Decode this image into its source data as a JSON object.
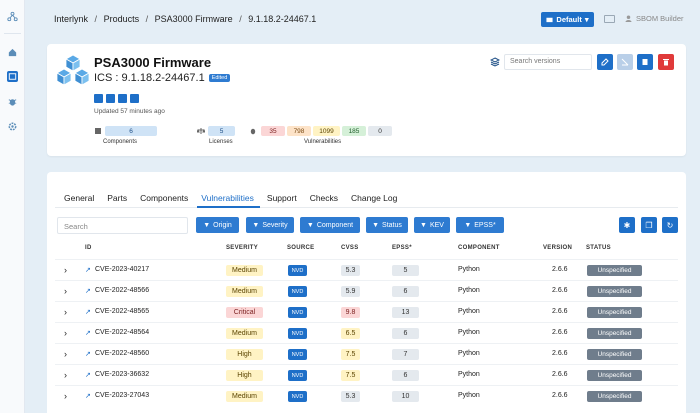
{
  "breadcrumb": [
    "Interlynk",
    "/",
    "Products",
    "/",
    "PSA3000 Firmware",
    "/",
    "9.1.18.2-24467.1"
  ],
  "header": {
    "default_label": "Default",
    "user_label": "SBOM Builder"
  },
  "product": {
    "title": "PSA3000 Firmware",
    "version": "ICS : 9.1.18.2-24467.1",
    "edited_badge": "Edited",
    "updated": "Updated 57 minutes ago",
    "search_placeholder": "Search versions",
    "stats": {
      "components": "6",
      "components_label": "Components",
      "licenses": "5",
      "licenses_label": "Licenses",
      "vuln": [
        "35",
        "798",
        "1099",
        "185",
        "0"
      ],
      "vuln_label": "Vulnerabilities"
    }
  },
  "tabs": [
    "General",
    "Parts",
    "Components",
    "Vulnerabilities",
    "Support",
    "Checks",
    "Change Log"
  ],
  "search_placeholder": "Search",
  "filters": [
    "Origin",
    "Severity",
    "Component",
    "Status",
    "KEV",
    "EPSS*"
  ],
  "columns": [
    "ID",
    "SEVERITY",
    "SOURCE",
    "CVSS",
    "EPSS*",
    "COMPONENT",
    "VERSION",
    "STATUS"
  ],
  "rows": [
    {
      "id": "CVE-2023-40217",
      "severity": "Medium",
      "source": "NVD",
      "cvss": "5.3",
      "epss": "5",
      "component": "Python",
      "version": "2.6.6",
      "status": "Unspecified"
    },
    {
      "id": "CVE-2022-48566",
      "severity": "Medium",
      "source": "NVD",
      "cvss": "5.9",
      "epss": "6",
      "component": "Python",
      "version": "2.6.6",
      "status": "Unspecified"
    },
    {
      "id": "CVE-2022-48565",
      "severity": "Critical",
      "source": "NVD",
      "cvss": "9.8",
      "epss": "13",
      "component": "Python",
      "version": "2.6.6",
      "status": "Unspecified"
    },
    {
      "id": "CVE-2022-48564",
      "severity": "Medium",
      "source": "NVD",
      "cvss": "6.5",
      "epss": "6",
      "component": "Python",
      "version": "2.6.6",
      "status": "Unspecified"
    },
    {
      "id": "CVE-2022-48560",
      "severity": "High",
      "source": "NVD",
      "cvss": "7.5",
      "epss": "7",
      "component": "Python",
      "version": "2.6.6",
      "status": "Unspecified"
    },
    {
      "id": "CVE-2023-36632",
      "severity": "High",
      "source": "NVD",
      "cvss": "7.5",
      "epss": "6",
      "component": "Python",
      "version": "2.6.6",
      "status": "Unspecified"
    },
    {
      "id": "CVE-2023-27043",
      "severity": "Medium",
      "source": "NVD",
      "cvss": "5.3",
      "epss": "10",
      "component": "Python",
      "version": "2.6.6",
      "status": "Unspecified"
    }
  ],
  "colors": {
    "accent": "#1e6fc8",
    "medium": "#fff3c4",
    "critical": "#fbd6d6",
    "status": "#6f7d8c"
  }
}
